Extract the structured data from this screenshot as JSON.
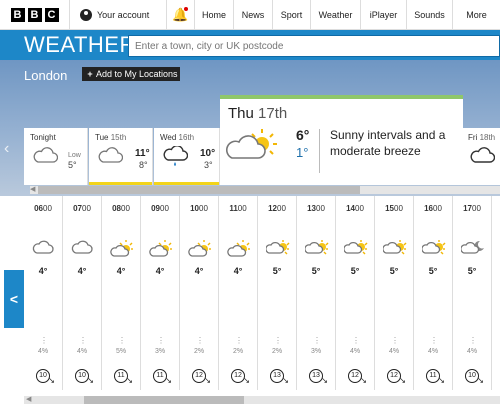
{
  "nav": {
    "logo_letters": [
      "B",
      "B",
      "C"
    ],
    "account": "Your account",
    "items": [
      "Home",
      "News",
      "Sport",
      "Weather",
      "iPlayer",
      "Sounds",
      "More"
    ]
  },
  "weather": {
    "title": "WEATHER",
    "search_placeholder": "Enter a town, city or UK postcode",
    "location": "London",
    "add_location": "Add to My Locations"
  },
  "days": [
    {
      "name": "Tonight",
      "date": "",
      "low_label": "Low",
      "low": "5°",
      "high": "",
      "icon": "cloud-icon",
      "bar": "#ffffff"
    },
    {
      "name": "Tue",
      "date": "15th",
      "high": "11°",
      "low": "8°",
      "icon": "cloud-icon",
      "bar": "#f3d41a"
    },
    {
      "name": "Wed",
      "date": "16th",
      "high": "10°",
      "low": "3°",
      "icon": "cloud-rain-icon",
      "bar": "#f3d41a"
    }
  ],
  "selected_day": {
    "name": "Thu",
    "date": "17th",
    "high": "6°",
    "low": "1°",
    "description": "Sunny intervals and a moderate breeze",
    "icon": "sun-cloud-icon",
    "bar": "#8fc76b"
  },
  "next_day": {
    "name": "Fri",
    "date": "18th",
    "icon": "cloud-icon"
  },
  "hours": [
    {
      "time_bold": "06",
      "time": "00",
      "icon": "cloud",
      "temp": "4°",
      "rain": "4%",
      "wind": "10"
    },
    {
      "time_bold": "07",
      "time": "00",
      "icon": "cloud",
      "temp": "4°",
      "rain": "4%",
      "wind": "10"
    },
    {
      "time_bold": "08",
      "time": "00",
      "icon": "sun-cloud",
      "temp": "4°",
      "rain": "5%",
      "wind": "11"
    },
    {
      "time_bold": "09",
      "time": "00",
      "icon": "sun-cloud",
      "temp": "4°",
      "rain": "3%",
      "wind": "11"
    },
    {
      "time_bold": "10",
      "time": "00",
      "icon": "sun-cloud",
      "temp": "4°",
      "rain": "2%",
      "wind": "12"
    },
    {
      "time_bold": "11",
      "time": "00",
      "icon": "sun-cloud",
      "temp": "4°",
      "rain": "2%",
      "wind": "12"
    },
    {
      "time_bold": "12",
      "time": "00",
      "icon": "sun-cloud-up",
      "temp": "5°",
      "rain": "2%",
      "wind": "13"
    },
    {
      "time_bold": "13",
      "time": "00",
      "icon": "sun-cloud-up",
      "temp": "5°",
      "rain": "3%",
      "wind": "13"
    },
    {
      "time_bold": "14",
      "time": "00",
      "icon": "sun-cloud-up",
      "temp": "5°",
      "rain": "4%",
      "wind": "12"
    },
    {
      "time_bold": "15",
      "time": "00",
      "icon": "sun-cloud-up",
      "temp": "5°",
      "rain": "4%",
      "wind": "12"
    },
    {
      "time_bold": "16",
      "time": "00",
      "icon": "sun-cloud-up",
      "temp": "5°",
      "rain": "4%",
      "wind": "11"
    },
    {
      "time_bold": "17",
      "time": "00",
      "icon": "moon-cloud-up",
      "temp": "5°",
      "rain": "4%",
      "wind": "10"
    }
  ]
}
